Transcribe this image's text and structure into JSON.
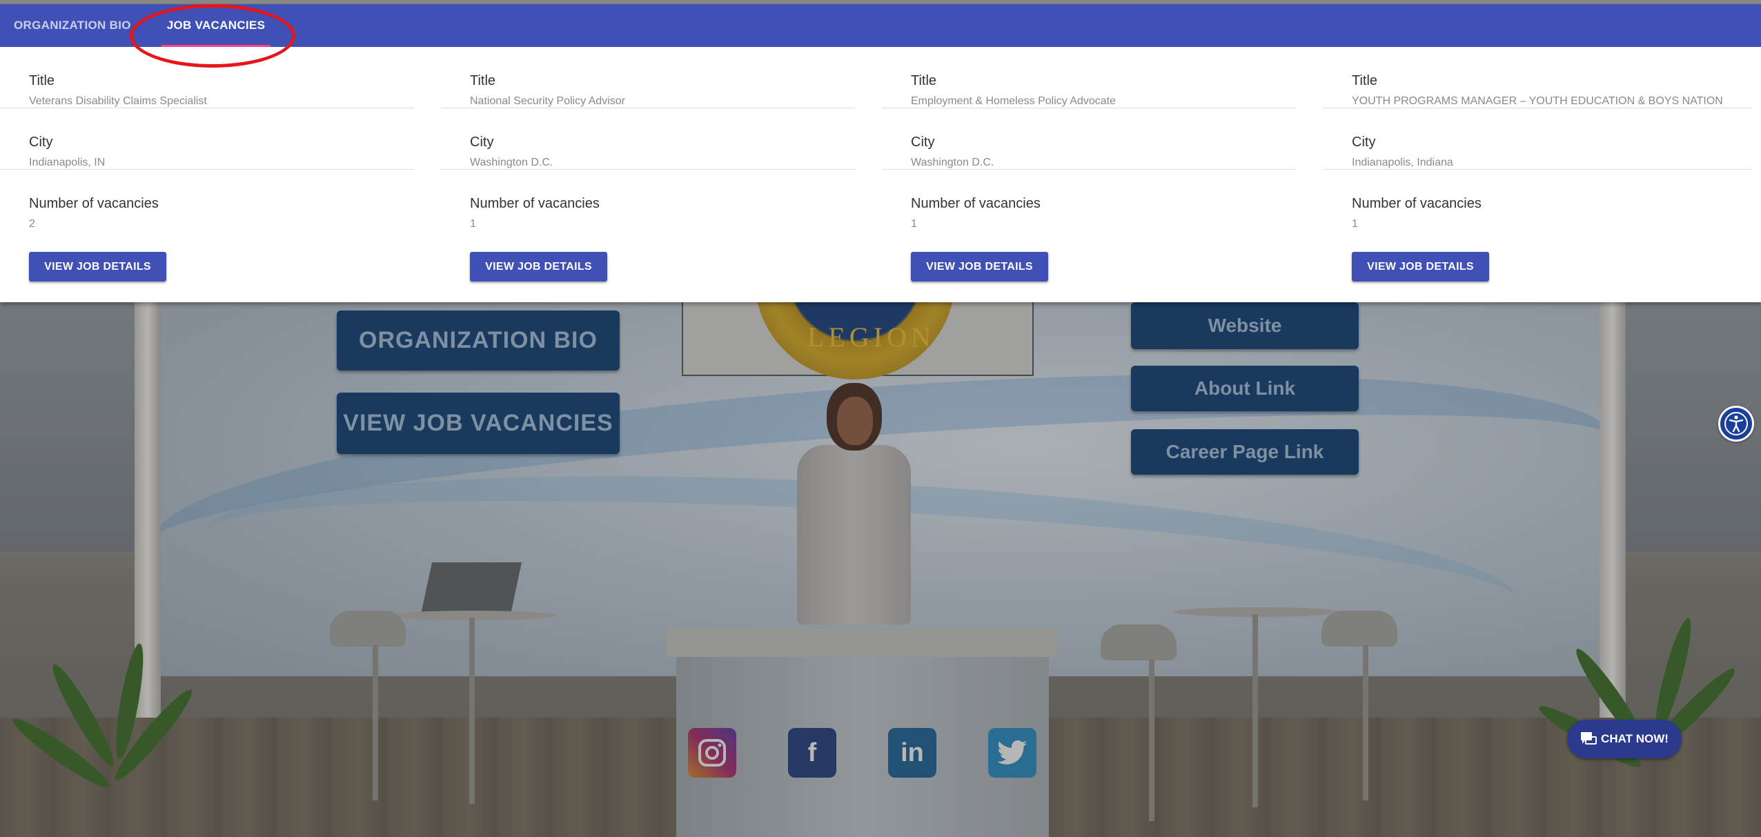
{
  "tabs": [
    {
      "label": "ORGANIZATION BIO",
      "active": false
    },
    {
      "label": "JOB VACANCIES",
      "active": true
    }
  ],
  "field_labels": {
    "title": "Title",
    "city": "City",
    "vacancies": "Number of vacancies"
  },
  "jobs": [
    {
      "title": "Veterans Disability Claims Specialist",
      "city": "Indianapolis, IN",
      "vacancies": "2",
      "button": "VIEW JOB DETAILS"
    },
    {
      "title": "National Security Policy Advisor",
      "city": "Washington D.C.",
      "vacancies": "1",
      "button": "VIEW JOB DETAILS"
    },
    {
      "title": "Employment & Homeless Policy Advocate",
      "city": "Washington D.C.",
      "vacancies": "1",
      "button": "VIEW JOB DETAILS"
    },
    {
      "title": "YOUTH PROGRAMS MANAGER – YOUTH EDUCATION & BOYS NATION",
      "city": "Indianapolis, Indiana",
      "vacancies": "1",
      "button": "VIEW JOB DETAILS"
    }
  ],
  "booth": {
    "left_buttons": [
      "ORGANIZATION BIO",
      "VIEW JOB VACANCIES"
    ],
    "right_buttons": [
      "Website",
      "About Link",
      "Career Page Link"
    ],
    "logo_text": "LEGION",
    "social_icons": [
      "instagram-icon",
      "facebook-icon",
      "linkedin-icon",
      "twitter-icon"
    ]
  },
  "chat": {
    "label": "CHAT NOW!"
  },
  "colors": {
    "primary": "#3f51b5",
    "booth_button": "#163f70",
    "annotation": "#e8141c",
    "chat": "#2c3a8e"
  }
}
